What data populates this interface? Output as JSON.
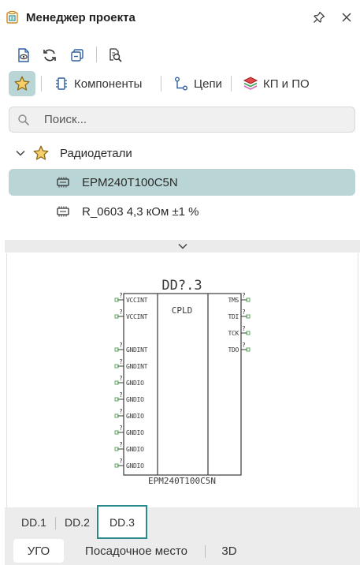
{
  "header": {
    "title": "Менеджер проекта",
    "icons": {
      "app": "project-manager-icon",
      "pin": "pin-icon",
      "close": "close-icon"
    }
  },
  "toolbar": {
    "buttons": [
      "document-view-icon",
      "refresh-icon",
      "collapse-all-icon",
      "find-in-document-icon"
    ]
  },
  "nav": {
    "favorites_icon": "star-icon",
    "items": [
      {
        "label": "Компоненты",
        "icon": "component-icon"
      },
      {
        "label": "Цепи",
        "icon": "net-icon"
      },
      {
        "label": "КП и ПО",
        "icon": "layers-icon"
      }
    ]
  },
  "search": {
    "placeholder": "Поиск...",
    "value": ""
  },
  "tree": {
    "group": {
      "label": "Радиодетали",
      "expanded": true
    },
    "items": [
      {
        "label": "EPM240T100C5N",
        "selected": true
      },
      {
        "label": "R_0603 4,3 кОм ±1 %",
        "selected": false
      }
    ]
  },
  "symbol": {
    "refdes": "DD?.3",
    "part": "EPM240T100C5N",
    "center_label": "CPLD",
    "left_pins": [
      {
        "num": "?",
        "name": "VCCINT"
      },
      {
        "num": "?",
        "name": "VCCINT"
      },
      {
        "num": "?",
        "name": "GNDINT"
      },
      {
        "num": "?",
        "name": "GNDINT"
      },
      {
        "num": "?",
        "name": "GNDIO"
      },
      {
        "num": "?",
        "name": "GNDIO"
      },
      {
        "num": "?",
        "name": "GNDIO"
      },
      {
        "num": "?",
        "name": "GNDIO"
      },
      {
        "num": "?",
        "name": "GNDIO"
      },
      {
        "num": "?",
        "name": "GNDIO"
      }
    ],
    "right_pins": [
      {
        "num": "?",
        "name": "TMS"
      },
      {
        "num": "?",
        "name": "TDI"
      },
      {
        "num": "?",
        "name": "TCK"
      },
      {
        "num": "?",
        "name": "TDO"
      }
    ],
    "colors": {
      "outline": "#3a3a3a",
      "pin_end": "#58a858"
    }
  },
  "subtabs": {
    "items": [
      "DD.1",
      "DD.2",
      "DD.3"
    ],
    "active": "DD.3"
  },
  "bottom_tabs": {
    "items": [
      "УГО",
      "Посадочное место",
      "3D"
    ],
    "active": "УГО"
  },
  "colors": {
    "accent": "#2a8a8a",
    "selection": "#b9d5d6"
  }
}
